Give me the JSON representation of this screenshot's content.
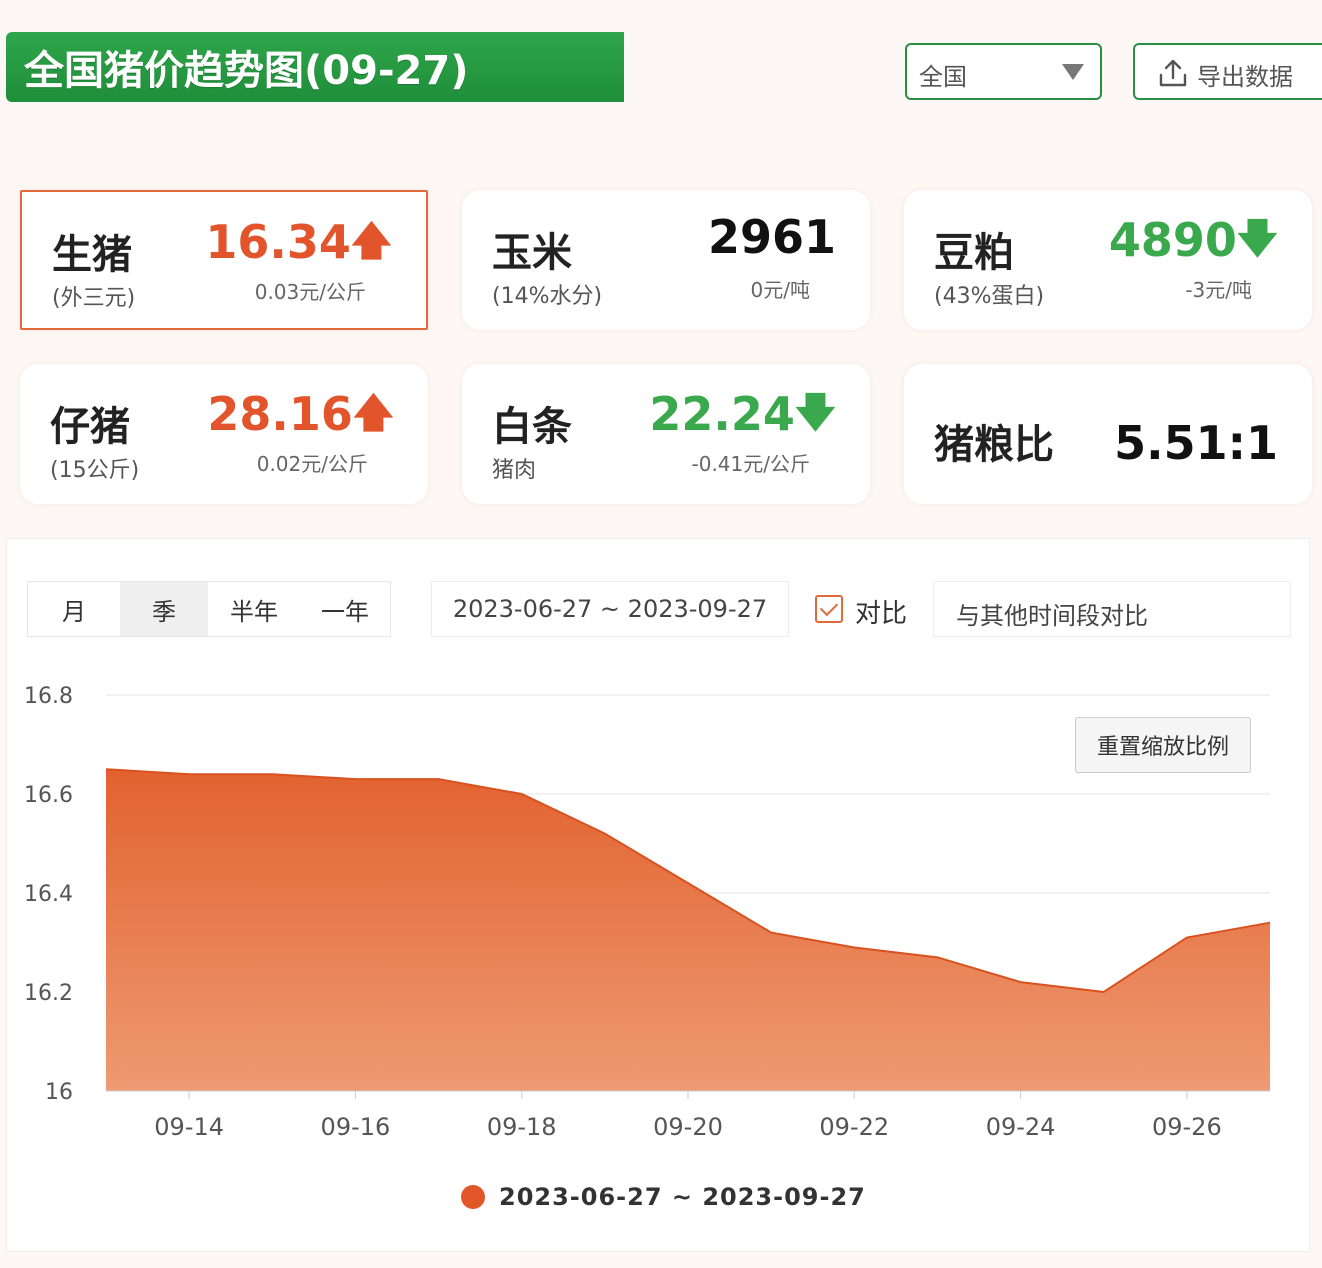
{
  "header": {
    "title": "全国猪价趋势图(09-27)",
    "region_selected": "全国",
    "export_label": "导出数据"
  },
  "cards": [
    {
      "name": "生猪",
      "sub": "(外三元)",
      "value": "16.34",
      "trend": "up",
      "change": "0.03元/公斤",
      "selected": true
    },
    {
      "name": "玉米",
      "sub": "(14%水分)",
      "value": "2961",
      "trend": "none",
      "change": "0元/吨",
      "selected": false
    },
    {
      "name": "豆粕",
      "sub": "(43%蛋白)",
      "value": "4890",
      "trend": "down",
      "change": "-3元/吨",
      "selected": false
    },
    {
      "name": "仔猪",
      "sub": "(15公斤)",
      "value": "28.16",
      "trend": "up",
      "change": "0.02元/公斤",
      "selected": false
    },
    {
      "name": "白条",
      "sub": "猪肉",
      "value": "22.24",
      "trend": "down",
      "change": "-0.41元/公斤",
      "selected": false
    },
    {
      "name": "猪粮比",
      "sub": "",
      "value": "5.51:1",
      "trend": "none",
      "change": "",
      "selected": false
    }
  ],
  "colors": {
    "up": "#e2552c",
    "down": "#3aa84c",
    "brand": "#2ea64a",
    "area": "#e2622f"
  },
  "controls": {
    "periods": [
      "月",
      "季",
      "半年",
      "一年"
    ],
    "active_period": "季",
    "date_range": "2023-06-27 ~ 2023-09-27",
    "compare_label": "对比",
    "compare_checked": true,
    "compare_placeholder": "与其他时间段对比",
    "reset_zoom_label": "重置缩放比例"
  },
  "chart_data": {
    "type": "area",
    "x": [
      "09-13",
      "09-14",
      "09-15",
      "09-16",
      "09-17",
      "09-18",
      "09-19",
      "09-20",
      "09-21",
      "09-22",
      "09-23",
      "09-24",
      "09-25",
      "09-26",
      "09-27"
    ],
    "x_tick_labels": [
      "09-14",
      "09-16",
      "09-18",
      "09-20",
      "09-22",
      "09-24",
      "09-26"
    ],
    "series": [
      {
        "name": "2023-06-27 ~ 2023-09-27",
        "values": [
          16.65,
          16.64,
          16.64,
          16.63,
          16.63,
          16.6,
          16.52,
          16.42,
          16.32,
          16.29,
          16.27,
          16.22,
          16.2,
          16.31,
          16.34
        ]
      }
    ],
    "ylim": [
      16,
      16.8
    ],
    "y_ticks": [
      "16",
      "16.2",
      "16.4",
      "16.6",
      "16.8"
    ],
    "grid": true,
    "legend_position": "bottom-center"
  }
}
